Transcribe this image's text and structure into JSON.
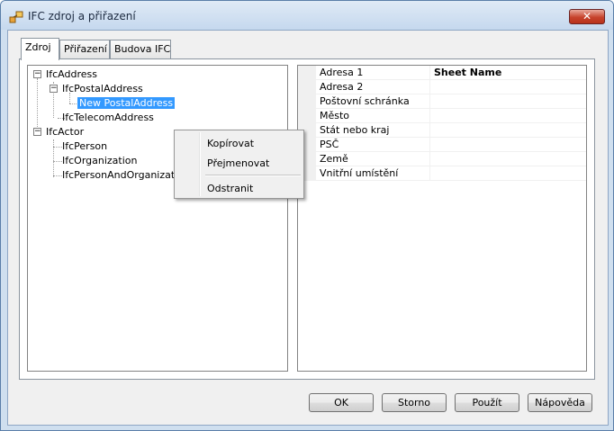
{
  "window": {
    "title": "IFC zdroj a přiřazení",
    "close_glyph": "✕"
  },
  "tabs": [
    {
      "label": "Zdroj"
    },
    {
      "label": "Přiřazení"
    },
    {
      "label": "Budova IFC"
    }
  ],
  "tree": {
    "nodes": {
      "ifcaddress": "IfcAddress",
      "ifcpostaladdress": "IfcPostalAddress",
      "newpostaladdress": "New PostalAddress",
      "ifctelecomaddress": "IfcTelecomAddress",
      "ifcactor": "IfcActor",
      "ifcperson": "IfcPerson",
      "ifcorganization": "IfcOrganization",
      "ifcpersonandorganization": "IfcPersonAndOrganization"
    },
    "expander_glyph": "−"
  },
  "context_menu": {
    "copy": "Kopírovat",
    "rename": "Přejmenovat",
    "delete": "Odstranit"
  },
  "properties": [
    {
      "name": "Adresa 1",
      "value": "Sheet Name"
    },
    {
      "name": "Adresa 2",
      "value": ""
    },
    {
      "name": "Poštovní schránka",
      "value": ""
    },
    {
      "name": "Město",
      "value": ""
    },
    {
      "name": "Stát nebo kraj",
      "value": ""
    },
    {
      "name": "PSČ",
      "value": ""
    },
    {
      "name": "Země",
      "value": ""
    },
    {
      "name": "Vnitřní umístění",
      "value": ""
    }
  ],
  "buttons": {
    "ok": "OK",
    "cancel": "Storno",
    "apply": "Použít",
    "help": "Nápověda"
  },
  "colors": {
    "selection": "#3399ff",
    "close_button": "#c7432c"
  }
}
